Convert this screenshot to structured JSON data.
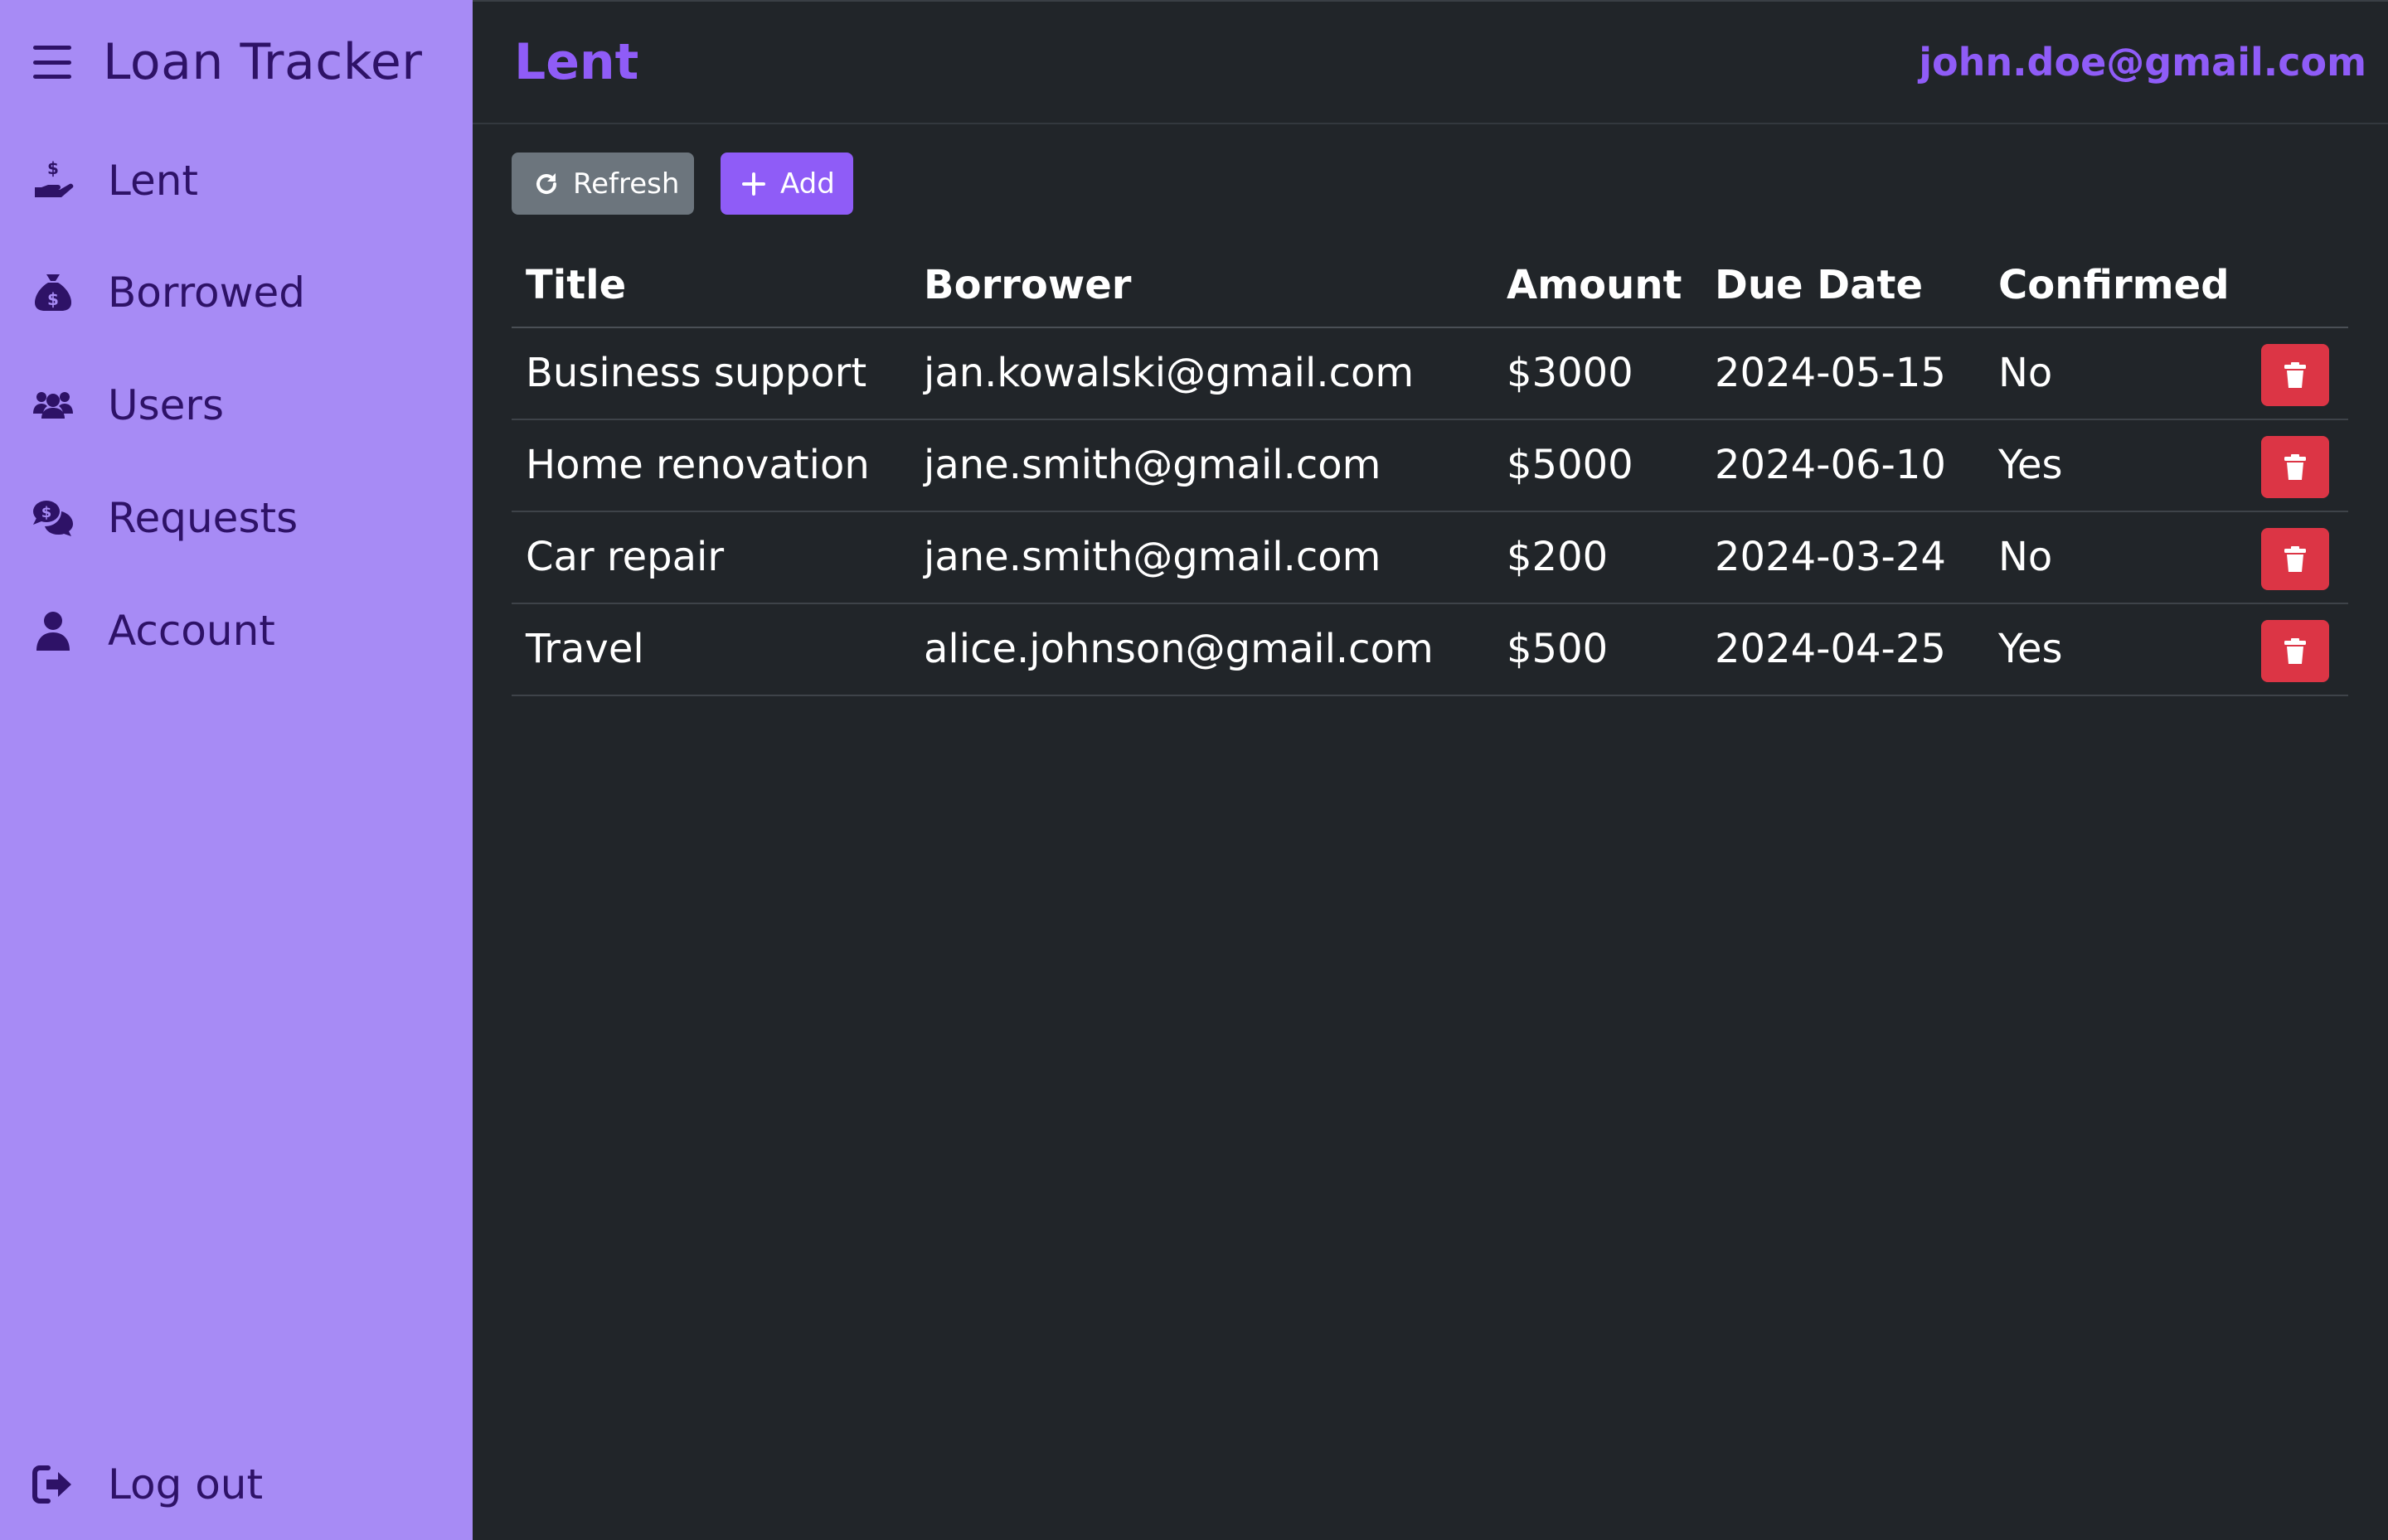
{
  "app": {
    "title": "Loan Tracker"
  },
  "sidebar": {
    "items": [
      {
        "label": "Lent",
        "icon": "hand-holding-dollar-icon"
      },
      {
        "label": "Borrowed",
        "icon": "money-bag-icon"
      },
      {
        "label": "Users",
        "icon": "users-icon"
      },
      {
        "label": "Requests",
        "icon": "comments-dollar-icon"
      },
      {
        "label": "Account",
        "icon": "user-icon"
      }
    ],
    "logout_label": "Log out"
  },
  "header": {
    "page_title": "Lent",
    "user_email": "john.doe@gmail.com"
  },
  "toolbar": {
    "refresh_label": "Refresh",
    "add_label": "Add"
  },
  "table": {
    "columns": [
      "Title",
      "Borrower",
      "Amount",
      "Due Date",
      "Confirmed"
    ],
    "rows": [
      {
        "title": "Business support",
        "borrower": "jan.kowalski@gmail.com",
        "amount": "$3000",
        "due_date": "2024-05-15",
        "confirmed": "No"
      },
      {
        "title": "Home renovation",
        "borrower": "jane.smith@gmail.com",
        "amount": "$5000",
        "due_date": "2024-06-10",
        "confirmed": "Yes"
      },
      {
        "title": "Car repair",
        "borrower": "jane.smith@gmail.com",
        "amount": "$200",
        "due_date": "2024-03-24",
        "confirmed": "No"
      },
      {
        "title": "Travel",
        "borrower": "alice.johnson@gmail.com",
        "amount": "$500",
        "due_date": "2024-04-25",
        "confirmed": "Yes"
      }
    ]
  },
  "colors": {
    "sidebar_bg": "#a78bf5",
    "sidebar_text": "#2e1267",
    "accent": "#8f5cf7",
    "content_bg": "#212529",
    "danger": "#dc3545",
    "secondary": "#6c757d"
  }
}
